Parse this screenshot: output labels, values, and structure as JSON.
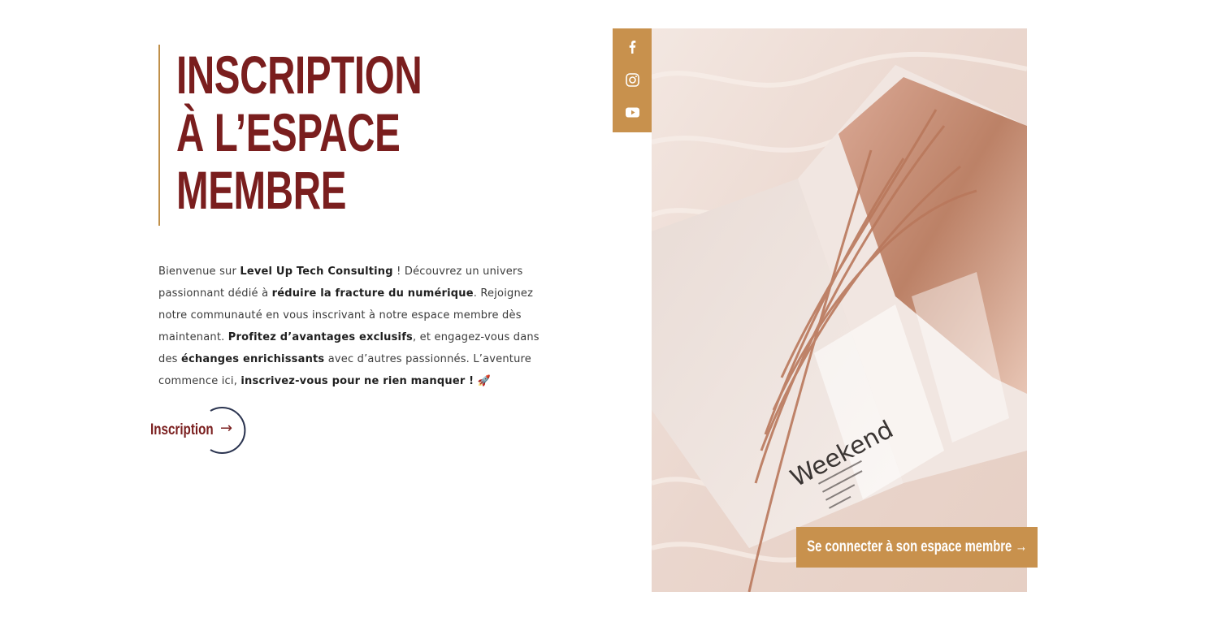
{
  "heading": {
    "line1": "INSCRIPTION",
    "line2": "À L’ESPACE",
    "line3": "MEMBRE"
  },
  "intro": {
    "p1": "Bienvenue sur ",
    "b1": "Level Up Tech Consulting",
    "p2": " ! Découvrez un univers passionnant dédié à ",
    "b2": "réduire la fracture du numérique",
    "p3": ". Rejoignez notre communauté en vous inscrivant à notre espace membre dès maintenant. ",
    "b3": "Profitez d’avantages exclusifs",
    "p4": ", et engagez-vous dans des ",
    "b4": "échanges enrichissants",
    "p5": " avec d’autres passionnés. L’aventure commence ici, ",
    "b5": "inscrivez-vous pour ne rien manquer !",
    "emoji": " 🚀"
  },
  "signup": {
    "label": "Inscription",
    "arrow": "→"
  },
  "social": {
    "icons": [
      "facebook-icon",
      "instagram-icon",
      "youtube-icon"
    ]
  },
  "photo": {
    "magazine_text": "Weekend"
  },
  "login_button": {
    "label": "Se connecter à son espace membre →"
  },
  "colors": {
    "brand_dark_red": "#7a1e1e",
    "accent_gold": "#c8914d",
    "text_gray": "#3b3b3b",
    "ring_navy": "#2b3450"
  }
}
